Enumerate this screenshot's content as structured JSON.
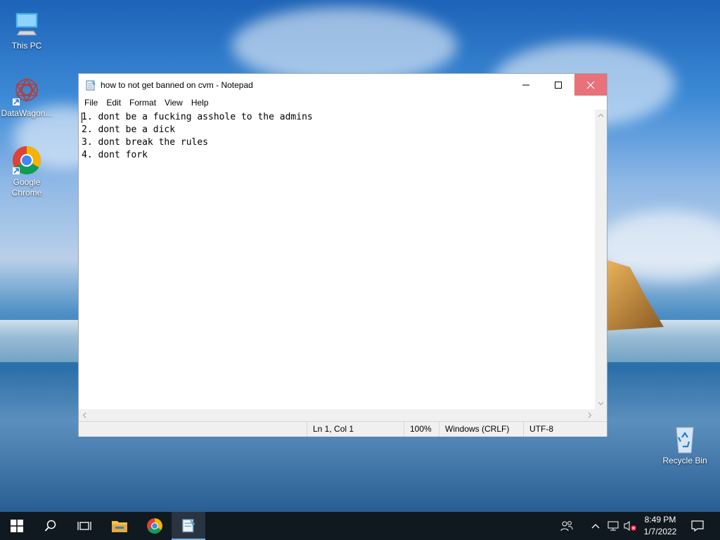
{
  "desktop": {
    "icons": [
      {
        "label": "This PC"
      },
      {
        "label": "DataWagon..."
      },
      {
        "label": "Google Chrome"
      },
      {
        "label": "Recycle Bin"
      }
    ]
  },
  "window": {
    "title": "how to not get banned on cvm - Notepad",
    "menu": [
      "File",
      "Edit",
      "Format",
      "View",
      "Help"
    ],
    "content_lines": [
      "1. dont be a fucking asshole to the admins",
      "2. dont be a dick",
      "3. dont break the rules",
      "4. dont fork"
    ],
    "status": {
      "position": "Ln 1, Col 1",
      "zoom": "100%",
      "line_endings": "Windows (CRLF)",
      "encoding": "UTF-8"
    }
  },
  "taskbar": {
    "time": "8:49 PM",
    "date": "1/7/2022"
  },
  "colors": {
    "close_button": "#e8717a",
    "taskbar_bg": "#101820"
  }
}
